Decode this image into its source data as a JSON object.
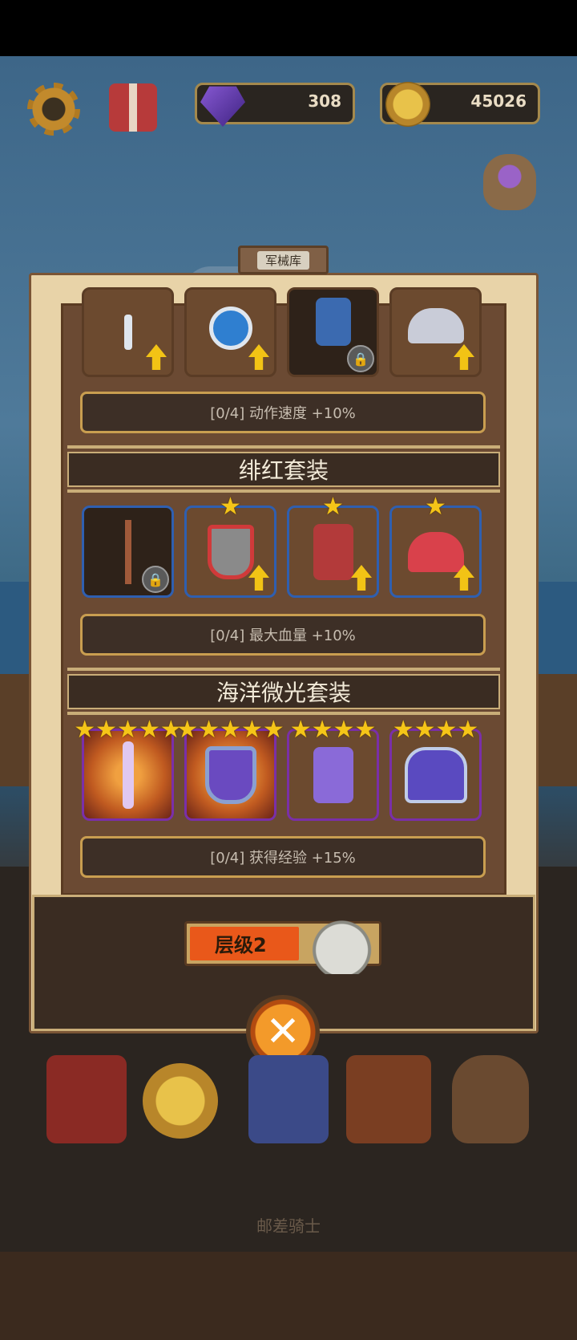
{
  "hud": {
    "gems": "308",
    "coins": "45026",
    "icons": [
      "gear-icon",
      "gift-icon",
      "gem-icon",
      "coin-icon",
      "gem-bag-icon"
    ]
  },
  "panel": {
    "title": "军械库",
    "sets": [
      {
        "name": "",
        "bonus": "[0/4] 动作速度 +10%"
      },
      {
        "name": "绯红套装",
        "bonus": "[0/4] 最大血量 +10%"
      },
      {
        "name": "海洋微光套装",
        "bonus": "[0/4] 获得经验 +15%"
      }
    ],
    "tier_label": "层级2",
    "tier_progress": 0.6
  },
  "colors": {
    "accent_gold": "#f2c315",
    "close_orange": "#f39a2a",
    "rare_blue": "#2f5fb0",
    "epic_purple": "#7a2fa8"
  },
  "footer_label": "邮差骑士"
}
